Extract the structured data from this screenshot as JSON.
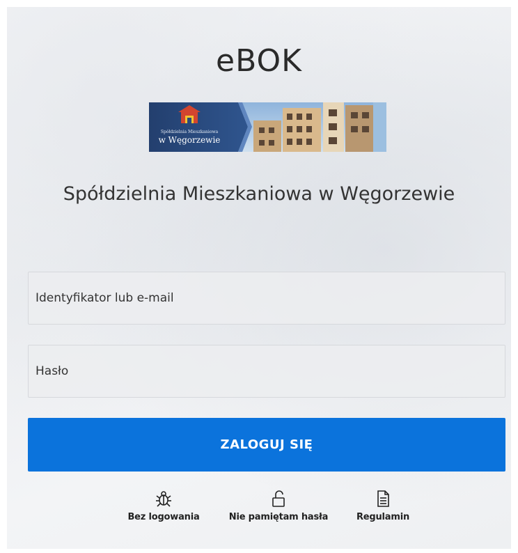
{
  "app": {
    "title": "eBOK"
  },
  "logo": {
    "text_line1": "Spółdzielnia Mieszkaniowa",
    "text_line2": "w Węgorzewie"
  },
  "organization": {
    "name": "Spółdzielnia Mieszkaniowa w Węgorzewie"
  },
  "login_form": {
    "identifier_placeholder": "Identyfikator lub e-mail",
    "identifier_value": "",
    "password_placeholder": "Hasło",
    "password_value": "",
    "submit_label": "ZALOGUJ SIĘ"
  },
  "footer_links": [
    {
      "label": "Bez logowania",
      "icon": "bug-icon"
    },
    {
      "label": "Nie pamiętam hasła",
      "icon": "unlock-icon"
    },
    {
      "label": "Regulamin",
      "icon": "document-icon"
    }
  ],
  "colors": {
    "accent": "#0b73dc",
    "logo_background": "#2c4a7c"
  }
}
